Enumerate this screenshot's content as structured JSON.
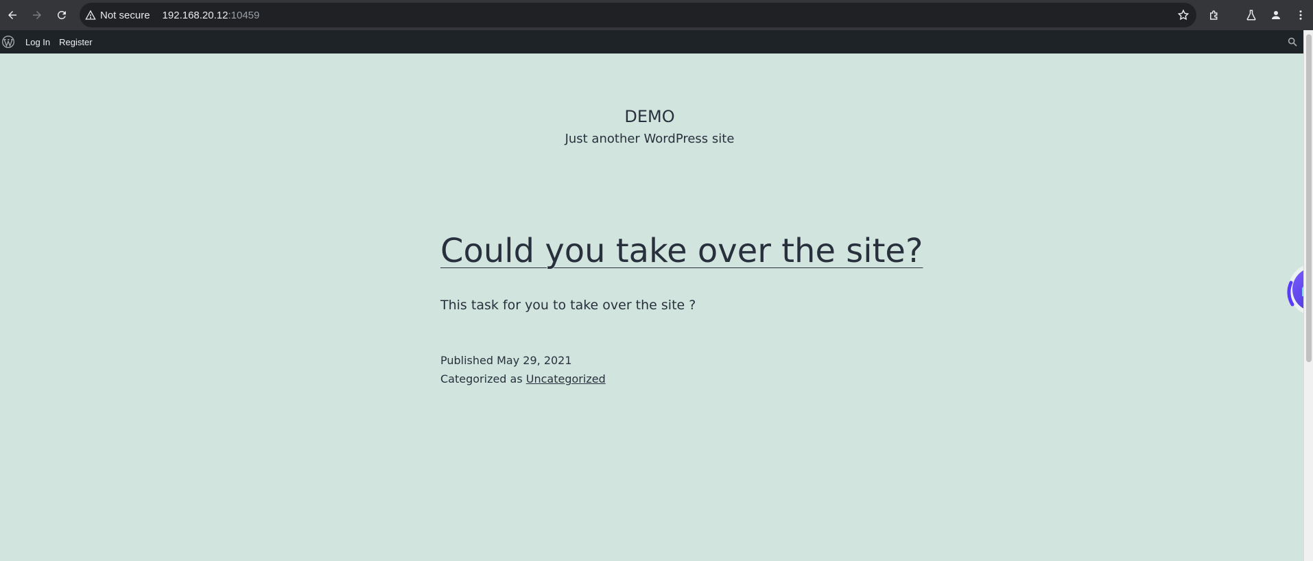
{
  "browser": {
    "not_secure_label": "Not secure",
    "url_host": "192.168.20.12",
    "url_port": ":10459"
  },
  "admin_bar": {
    "login_label": "Log In",
    "register_label": "Register"
  },
  "site": {
    "title": "DEMO",
    "tagline": "Just another WordPress site"
  },
  "post": {
    "title": "Could you take over the site?",
    "body": "This task for you to take over the site ?",
    "published_label": "Published May 29, 2021",
    "category_prefix": "Categorized as ",
    "category": "Uncategorized"
  },
  "colors": {
    "background": "#d1e4dd",
    "text": "#28303d",
    "admin_bar": "#1d2327",
    "browser_bar": "#35363a"
  }
}
